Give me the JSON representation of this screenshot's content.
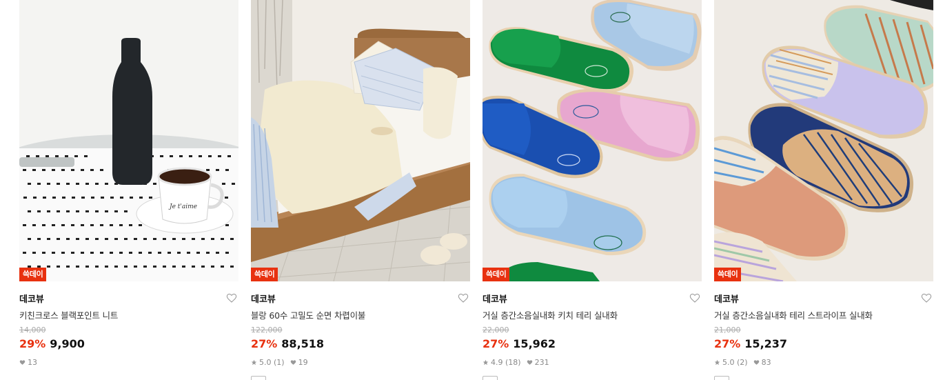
{
  "products": [
    {
      "badge": "쓱데이",
      "brand": "데코뷰",
      "name": "키친크로스 블랙포인트 니트",
      "original_price": "14,000",
      "discount": "29%",
      "price": "9,900",
      "rating": "",
      "likes": "13",
      "image_icon": "kitchen-cloth-photo"
    },
    {
      "badge": "쓱데이",
      "brand": "데코뷰",
      "name": "블랑 60수 고밀도 순면 차렵이불",
      "original_price": "122,000",
      "discount": "27%",
      "price": "88,518",
      "rating": "5.0 (1)",
      "likes": "19",
      "image_icon": "bedding-photo"
    },
    {
      "badge": "쓱데이",
      "brand": "데코뷰",
      "name": "거실 층간소음실내화 키치 테리 실내화",
      "original_price": "22,000",
      "discount": "27%",
      "price": "15,962",
      "rating": "4.9 (18)",
      "likes": "231",
      "image_icon": "slippers-photo"
    },
    {
      "badge": "쓱데이",
      "brand": "데코뷰",
      "name": "거실 층간소음실내화 테리 스트라이프 실내화",
      "original_price": "21,000",
      "discount": "27%",
      "price": "15,237",
      "rating": "5.0 (2)",
      "likes": "83",
      "image_icon": "striped-slippers-photo"
    }
  ],
  "colors": {
    "badge": "#e8310f",
    "discount": "#e8310f",
    "muted": "#888888"
  }
}
